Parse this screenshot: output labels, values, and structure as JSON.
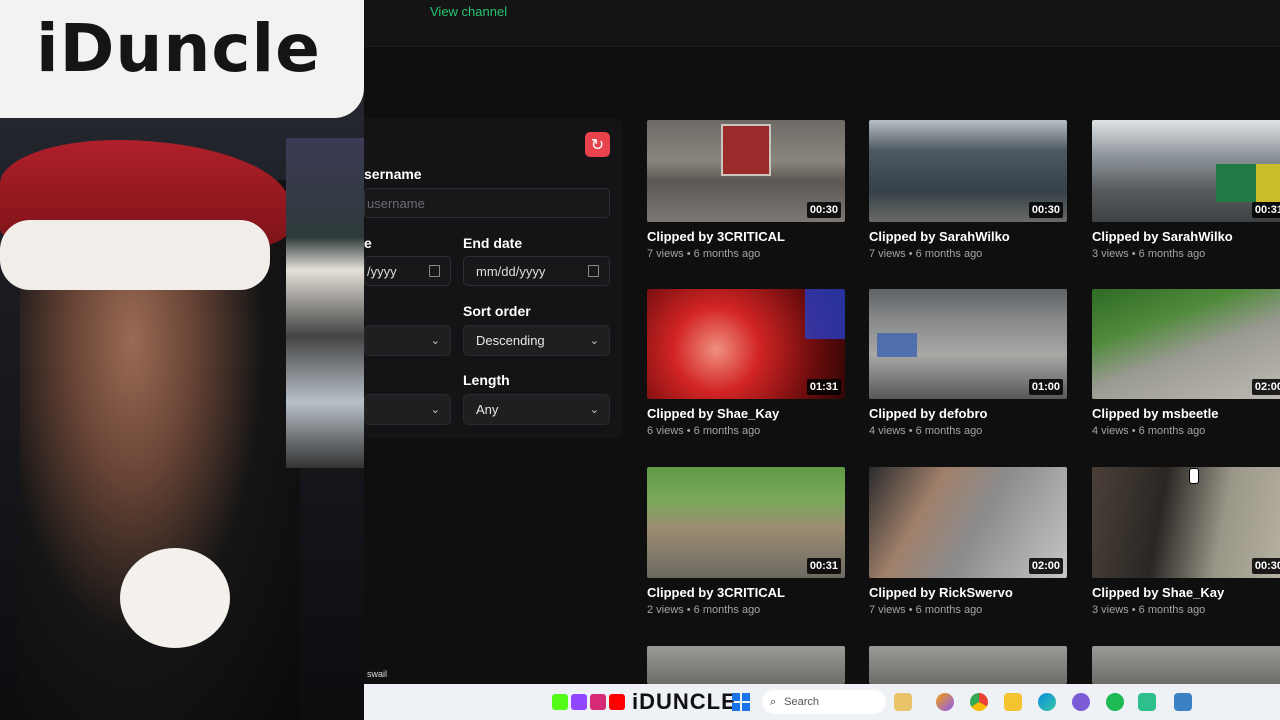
{
  "topbar": {
    "link_text": "View channel"
  },
  "filters": {
    "username_label": "sername",
    "username_placeholder": "username",
    "start_label": "e",
    "start_value": "/yyyy",
    "end_label": "End date",
    "end_value": "mm/dd/yyyy",
    "sort_label": "Sort order",
    "sort_value": "Descending",
    "length_label": "Length",
    "length_value": "Any"
  },
  "clips": [
    {
      "title": "Clipped by 3CRITICAL",
      "meta": "7 views • 6 months ago",
      "duration": "00:30"
    },
    {
      "title": "Clipped by SarahWilko",
      "meta": "7 views • 6 months ago",
      "duration": "00:30"
    },
    {
      "title": "Clipped by SarahWilko",
      "meta": "3 views • 6 months ago",
      "duration": "00:31"
    },
    {
      "title": "Clipped by Shae_Kay",
      "meta": "6 views • 6 months ago",
      "duration": "01:31"
    },
    {
      "title": "Clipped by defobro",
      "meta": "4 views • 6 months ago",
      "duration": "01:00"
    },
    {
      "title": "Clipped by msbeetle",
      "meta": "4 views • 6 months ago",
      "duration": "02:00"
    },
    {
      "title": "Clipped by 3CRITICAL",
      "meta": "2 views • 6 months ago",
      "duration": "00:31"
    },
    {
      "title": "Clipped by RickSwervo",
      "meta": "7 views • 6 months ago",
      "duration": "02:00"
    },
    {
      "title": "Clipped by Shae_Kay",
      "meta": "3 views • 6 months ago",
      "duration": "00:30"
    }
  ],
  "overlay": {
    "sign_text": "iDuncle",
    "stream_tag": "swail"
  },
  "taskbar": {
    "brand_text": "iDUNCLE",
    "search_placeholder": "Search"
  },
  "colors": {
    "accent_red": "#e8424c",
    "link_green": "#27c46b"
  },
  "icons": [
    "refresh-icon",
    "chevron-down-icon",
    "calendar-icon",
    "windows-start-icon",
    "search-icon"
  ]
}
